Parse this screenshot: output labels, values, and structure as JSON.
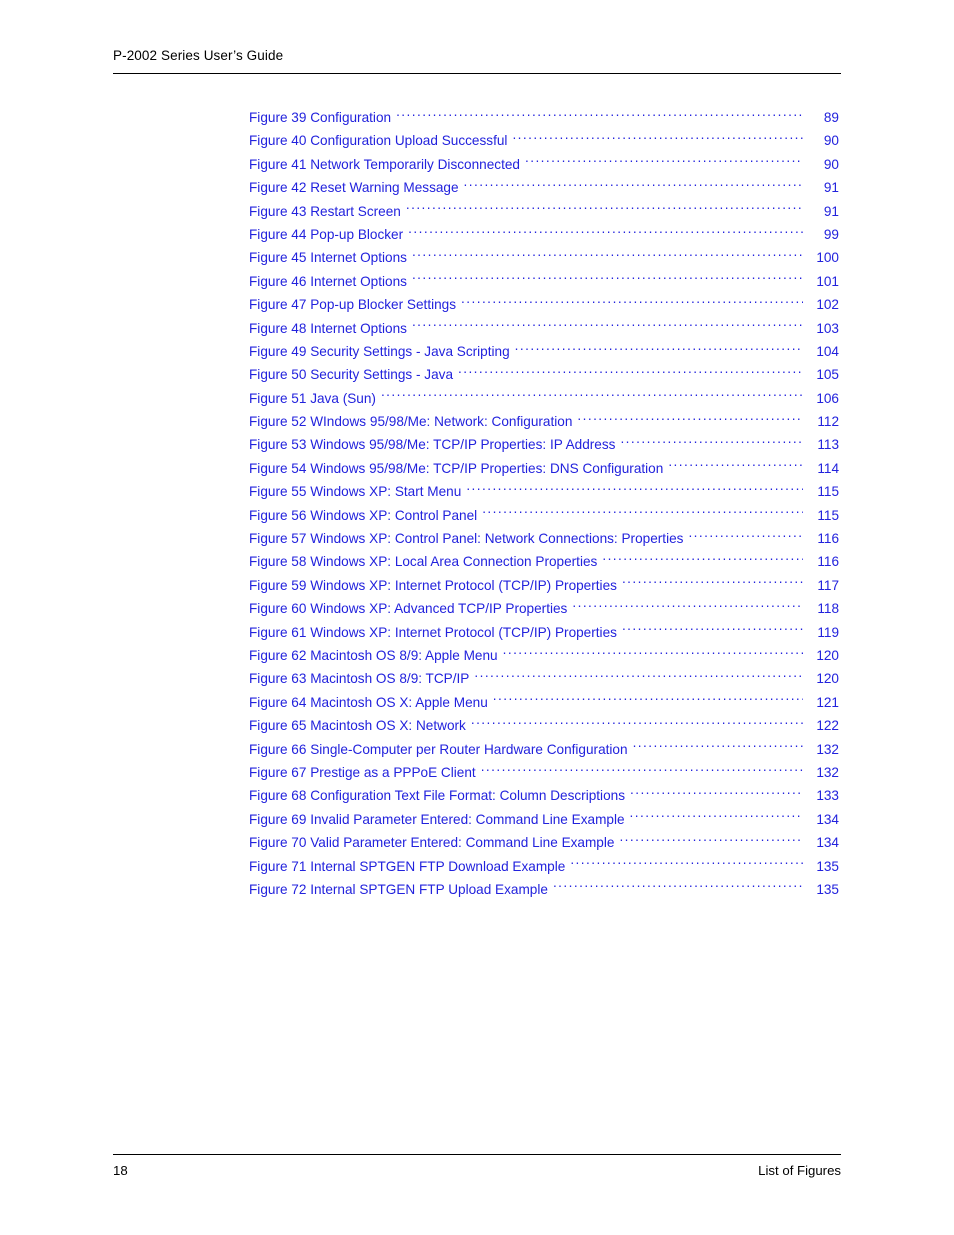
{
  "document": {
    "header_title": "P-2002 Series User’s Guide",
    "footer_page_number": "18",
    "footer_section": "List of Figures",
    "link_color": "#2222dd",
    "text_color": "#000000"
  },
  "figure_list": [
    {
      "label": "Figure 39  Configuration",
      "page": "89"
    },
    {
      "label": "Figure 40 Configuration Upload Successful",
      "page": "90"
    },
    {
      "label": "Figure 41 Network Temporarily Disconnected",
      "page": "90"
    },
    {
      "label": "Figure 42 Reset Warning Message",
      "page": "91"
    },
    {
      "label": "Figure 43 Restart Screen",
      "page": "91"
    },
    {
      "label": "Figure 44 Pop-up Blocker",
      "page": "99"
    },
    {
      "label": "Figure 45  Internet Options",
      "page": "100"
    },
    {
      "label": "Figure 46 Internet Options",
      "page": "101"
    },
    {
      "label": "Figure 47 Pop-up Blocker Settings",
      "page": "102"
    },
    {
      "label": "Figure 48 Internet Options",
      "page": "103"
    },
    {
      "label": "Figure 49 Security Settings - Java Scripting",
      "page": "104"
    },
    {
      "label": "Figure 50 Security Settings - Java",
      "page": "105"
    },
    {
      "label": "Figure 51 Java (Sun)",
      "page": "106"
    },
    {
      "label": "Figure 52 WIndows 95/98/Me: Network: Configuration",
      "page": "112"
    },
    {
      "label": "Figure 53 Windows 95/98/Me: TCP/IP Properties: IP Address",
      "page": "113"
    },
    {
      "label": "Figure 54 Windows 95/98/Me: TCP/IP Properties: DNS Configuration",
      "page": "114"
    },
    {
      "label": "Figure 55 Windows XP: Start Menu",
      "page": "115"
    },
    {
      "label": "Figure 56 Windows XP: Control Panel",
      "page": "115"
    },
    {
      "label": "Figure 57 Windows XP: Control Panel: Network Connections: Properties",
      "page": "116"
    },
    {
      "label": "Figure 58 Windows XP: Local Area Connection Properties",
      "page": "116"
    },
    {
      "label": "Figure 59 Windows XP: Internet Protocol (TCP/IP) Properties",
      "page": "117"
    },
    {
      "label": "Figure 60 Windows XP: Advanced TCP/IP Properties",
      "page": "118"
    },
    {
      "label": "Figure 61 Windows XP: Internet Protocol (TCP/IP) Properties",
      "page": "119"
    },
    {
      "label": "Figure 62 Macintosh OS 8/9: Apple Menu",
      "page": "120"
    },
    {
      "label": "Figure 63 Macintosh OS 8/9: TCP/IP",
      "page": "120"
    },
    {
      "label": "Figure 64 Macintosh OS X: Apple Menu",
      "page": "121"
    },
    {
      "label": "Figure 65 Macintosh OS X: Network",
      "page": "122"
    },
    {
      "label": "Figure 66 Single-Computer per Router Hardware Configuration",
      "page": "132"
    },
    {
      "label": "Figure 67 Prestige as a PPPoE Client",
      "page": "132"
    },
    {
      "label": "Figure 68 Configuration Text File Format: Column Descriptions",
      "page": "133"
    },
    {
      "label": "Figure 69 Invalid Parameter Entered: Command Line Example",
      "page": "134"
    },
    {
      "label": "Figure 70 Valid Parameter Entered: Command Line Example",
      "page": "134"
    },
    {
      "label": "Figure 71  Internal SPTGEN FTP Download Example",
      "page": "135"
    },
    {
      "label": "Figure 72 Internal SPTGEN FTP Upload Example",
      "page": "135"
    }
  ]
}
